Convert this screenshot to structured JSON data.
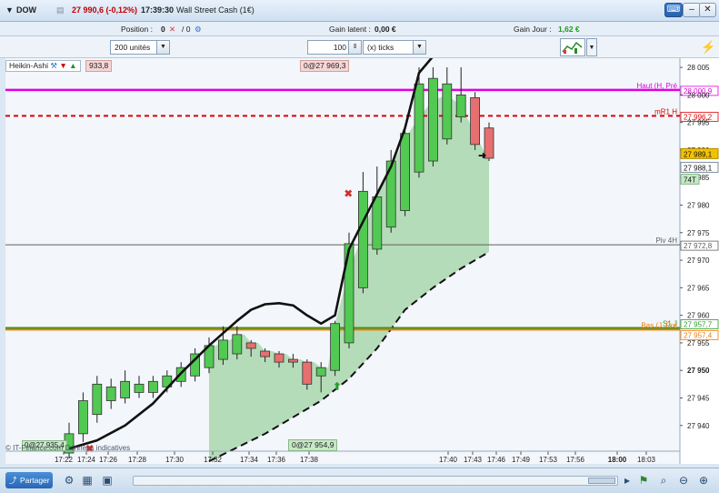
{
  "window": {
    "symbol": "DOW",
    "last_price": "27 990,6 (-0,12%)",
    "time": "17:39:30",
    "instrument_name": "Wall Street Cash (1€)"
  },
  "infobar": {
    "position_label": "Position :",
    "position_value": "0",
    "position_orders": "/ 0",
    "gain_latent_label": "Gain latent :",
    "gain_latent_value": "0,00 €",
    "gain_jour_label": "Gain Jour :",
    "gain_jour_value": "1,62 €"
  },
  "toolbar": {
    "units": "200 unités",
    "tick_count": "100",
    "tick_type": "(x) ticks"
  },
  "chart_data": {
    "type": "candlestick",
    "indicator_label": "Heikin-Ashi",
    "indicator_value": "933,8",
    "top_label": "0@27 969,3",
    "low_label_left": "0@27 935,4",
    "low_label_mid": "0@27 954,9",
    "watermark": "© IT-Finance.com Données indicatives",
    "ylim": [
      27936,
      28006
    ],
    "y_ticks": [
      "28 005",
      "28 000",
      "27 995",
      "27 990",
      "27 985",
      "27 980",
      "27 975",
      "27 970",
      "27 965",
      "27 960",
      "27 955",
      "27 950",
      "27 945",
      "27 940"
    ],
    "x_ticks": [
      "17:22",
      "17:24",
      "17:26",
      "17:28",
      "17:30",
      "17:32",
      "17:34",
      "17:36",
      "17:38",
      "17:40",
      "17:43",
      "17:46",
      "17:49",
      "17:53",
      "17:56",
      "18:00",
      "18:03"
    ],
    "levels": [
      {
        "name": "Haut (H, Pré",
        "value": 28000.9,
        "label": "28 000,9",
        "color": "#e000e0",
        "style": "solid"
      },
      {
        "name": "mR1 H",
        "value": 27996.2,
        "label": "27 996,2",
        "color": "#e00000",
        "style": "dashed"
      },
      {
        "name": "Piv 4H",
        "value": 27972.8,
        "label": "27 972,8",
        "color": "#606060",
        "style": "solid"
      },
      {
        "name": "S1 J",
        "value": 27957.7,
        "label": "27 957,7",
        "color": "#2e9a2e",
        "style": "solid"
      },
      {
        "name": "Bas (J, Pré",
        "value": 27957.4,
        "label": "27 957,4",
        "color": "#f07a00",
        "style": "solid"
      }
    ],
    "current_price_label": "27 989,1",
    "current_price_value": 27989.1,
    "bid_label": "27 988,1",
    "bid_value": 27988.1,
    "ticks_label": "74T",
    "candles": [
      {
        "o": 27935.0,
        "c": 27938.5,
        "h": 27940.5,
        "l": 27934.0
      },
      {
        "o": 27938.5,
        "c": 27944.5,
        "h": 27946.0,
        "l": 27937.0
      },
      {
        "o": 27942.0,
        "c": 27947.5,
        "h": 27949.0,
        "l": 27940.5
      },
      {
        "o": 27944.5,
        "c": 27947.0,
        "h": 27948.5,
        "l": 27943.0
      },
      {
        "o": 27945.0,
        "c": 27948.0,
        "h": 27950.0,
        "l": 27944.0
      },
      {
        "o": 27946.0,
        "c": 27947.5,
        "h": 27949.0,
        "l": 27945.0
      },
      {
        "o": 27946.0,
        "c": 27948.0,
        "h": 27949.0,
        "l": 27945.0
      },
      {
        "o": 27947.0,
        "c": 27949.0,
        "h": 27950.0,
        "l": 27946.0
      },
      {
        "o": 27948.0,
        "c": 27950.5,
        "h": 27951.5,
        "l": 27947.0
      },
      {
        "o": 27949.0,
        "c": 27953.0,
        "h": 27954.0,
        "l": 27948.0
      },
      {
        "o": 27950.5,
        "c": 27954.5,
        "h": 27956.0,
        "l": 27949.5
      },
      {
        "o": 27952.0,
        "c": 27955.5,
        "h": 27958.0,
        "l": 27951.0
      },
      {
        "o": 27953.0,
        "c": 27956.5,
        "h": 27958.0,
        "l": 27952.0
      },
      {
        "o": 27955.0,
        "c": 27954.0,
        "h": 27955.5,
        "l": 27952.5
      },
      {
        "o": 27953.5,
        "c": 27952.5,
        "h": 27954.0,
        "l": 27951.5
      },
      {
        "o": 27953.0,
        "c": 27951.5,
        "h": 27953.5,
        "l": 27950.5
      },
      {
        "o": 27952.0,
        "c": 27951.5,
        "h": 27953.0,
        "l": 27950.5
      },
      {
        "o": 27951.5,
        "c": 27947.5,
        "h": 27952.0,
        "l": 27946.5
      },
      {
        "o": 27949.0,
        "c": 27950.5,
        "h": 27951.5,
        "l": 27946.0
      },
      {
        "o": 27950.0,
        "c": 27958.5,
        "h": 27959.0,
        "l": 27949.0
      },
      {
        "o": 27955.0,
        "c": 27973.0,
        "h": 27975.0,
        "l": 27954.0
      },
      {
        "o": 27965.0,
        "c": 27982.5,
        "h": 27986.0,
        "l": 27964.0
      },
      {
        "o": 27972.0,
        "c": 27981.5,
        "h": 27987.0,
        "l": 27971.0
      },
      {
        "o": 27976.0,
        "c": 27988.0,
        "h": 27990.0,
        "l": 27975.0
      },
      {
        "o": 27979.0,
        "c": 27993.0,
        "h": 27994.0,
        "l": 27978.0
      },
      {
        "o": 27986.0,
        "c": 28002.0,
        "h": 28005.0,
        "l": 27985.0
      },
      {
        "o": 27988.0,
        "c": 28003.0,
        "h": 28005.0,
        "l": 27987.0
      },
      {
        "o": 27992.0,
        "c": 28002.0,
        "h": 28005.0,
        "l": 27991.0
      },
      {
        "o": 27996.0,
        "c": 28000.0,
        "h": 28005.0,
        "l": 27995.0
      },
      {
        "o": 27999.5,
        "c": 27991.0,
        "h": 28000.5,
        "l": 27990.0
      },
      {
        "o": 27994.0,
        "c": 27988.5,
        "h": 27995.0,
        "l": 27988.0
      }
    ],
    "ma_line": [
      [
        0,
        27935.8
      ],
      [
        2,
        27937.3
      ],
      [
        4,
        27940.0
      ],
      [
        6,
        27944.0
      ],
      [
        8,
        27949.5
      ],
      [
        10,
        27954.5
      ],
      [
        12,
        27959.0
      ],
      [
        13,
        27961.0
      ],
      [
        14,
        27962.0
      ],
      [
        15,
        27962.2
      ],
      [
        16,
        27961.8
      ],
      [
        17,
        27960.0
      ],
      [
        18,
        27958.5
      ],
      [
        19,
        27960.0
      ],
      [
        20,
        27972.0
      ],
      [
        21,
        27977.0
      ],
      [
        22,
        27982.0
      ],
      [
        23,
        27987.0
      ],
      [
        24,
        27994.0
      ],
      [
        25,
        28004.0
      ],
      [
        26,
        28007.0
      ]
    ],
    "cloud_upper": [
      [
        19,
        27958.5
      ],
      [
        20,
        27968.0
      ],
      [
        21,
        27975.0
      ],
      [
        22,
        27982.0
      ],
      [
        23,
        27987.0
      ],
      [
        24,
        27992.0
      ],
      [
        25,
        27996.0
      ],
      [
        26,
        27999.0
      ],
      [
        27,
        28000.0
      ],
      [
        28,
        27998.0
      ],
      [
        29,
        27993.0
      ],
      [
        30,
        27988.0
      ]
    ],
    "cloud_lower": [
      [
        10,
        27933.5
      ],
      [
        12,
        27936.0
      ],
      [
        14,
        27938.5
      ],
      [
        16,
        27941.5
      ],
      [
        18,
        27944.5
      ],
      [
        20,
        27948.5
      ],
      [
        22,
        27954.0
      ],
      [
        24,
        27961.0
      ],
      [
        26,
        27965.0
      ],
      [
        28,
        27968.5
      ],
      [
        30,
        27971.5
      ]
    ]
  },
  "bottombar": {
    "share_label": "Partager"
  }
}
